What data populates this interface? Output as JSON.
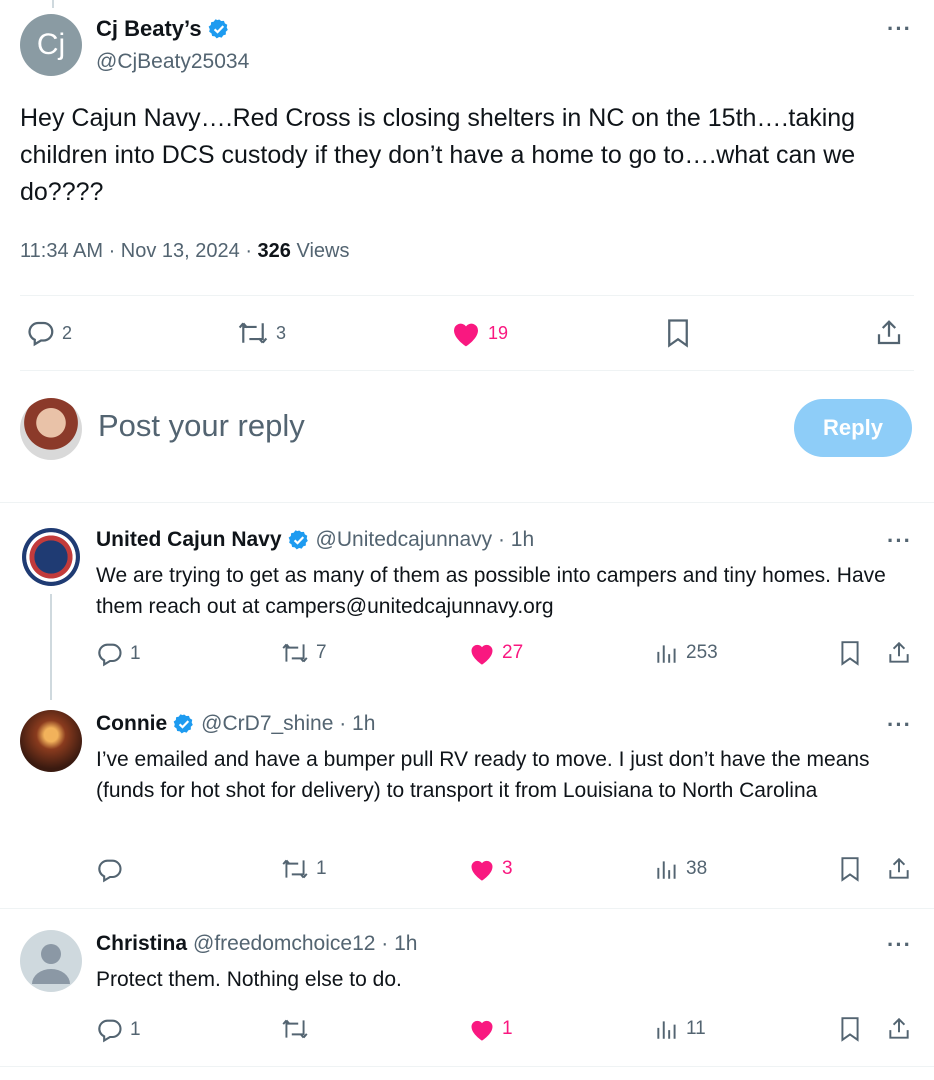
{
  "main": {
    "avatar_initials": "Cj",
    "name": "Cj Beaty’s",
    "handle": "@CjBeaty25034",
    "text": "Hey Cajun Navy….Red Cross is closing shelters in NC on the 15th….taking children into DCS custody if they don’t have a home to go to….what can we do????",
    "time": "11:34 AM · Nov 13, 2024 · ",
    "views_count": "326",
    "views_label": " Views",
    "replies": "2",
    "reposts": "3",
    "likes": "19"
  },
  "composer": {
    "placeholder": "Post your reply",
    "reply_label": "Reply"
  },
  "replies": [
    {
      "name": "United Cajun Navy",
      "handle": "@Unitedcajunnavy · 1h",
      "text": "We are trying to get as many of them as possible into campers and tiny homes. Have them reach out at campers@unitedcajunnavy.org",
      "replies": "1",
      "reposts": "7",
      "likes": "27",
      "views": "253"
    },
    {
      "name": "Connie",
      "handle": "@CrD7_shine · 1h",
      "text": "I’ve emailed and have a bumper pull RV ready to move. I just don’t have the means (funds for hot shot for delivery) to transport it from Louisiana to North Carolina",
      "replies": "",
      "reposts": "1",
      "likes": "3",
      "views": "38"
    },
    {
      "name": "Christina",
      "handle": "@freedomchoice12 · 1h",
      "text": "Protect them. Nothing else to do.",
      "replies": "1",
      "reposts": "",
      "likes": "1",
      "views": "11"
    }
  ],
  "colors": {
    "verified": "#1d9bf0",
    "like": "#f91880",
    "muted": "#536471",
    "reply_button": "#8ecdf8"
  },
  "icons": [
    "verified-badge-icon",
    "more-icon",
    "reply-icon",
    "repost-icon",
    "like-icon",
    "bookmark-icon",
    "share-icon",
    "views-icon",
    "default-avatar-icon"
  ]
}
